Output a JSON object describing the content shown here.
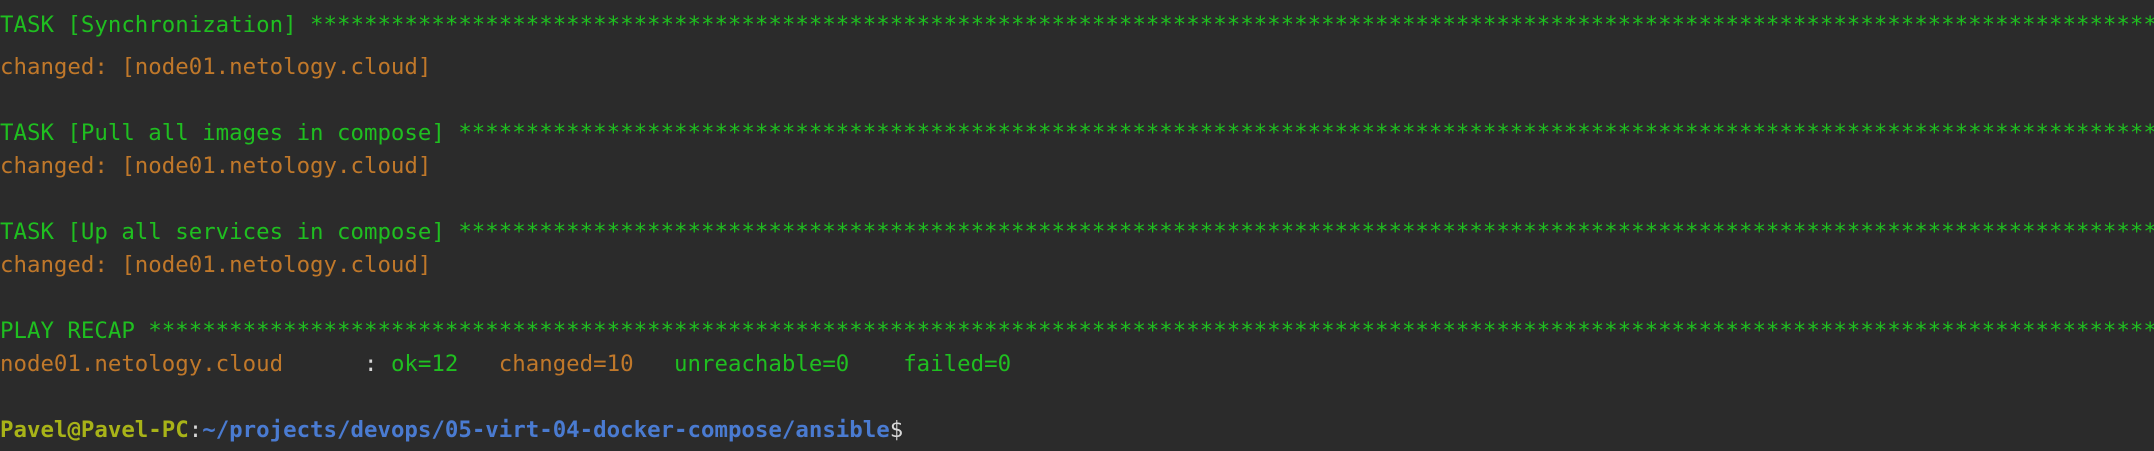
{
  "terminal": {
    "lines": {
      "task_sync": "TASK [Synchronization] ****************************************************************************************************************************************************************************************************************",
      "changed_sync": "changed: [node01.netology.cloud]",
      "task_pull": "TASK [Pull all images in compose] ****************************************************************************************************************************************************************************************************************",
      "changed_pull": "changed: [node01.netology.cloud]",
      "task_up": "TASK [Up all services in compose] ****************************************************************************************************************************************************************************************************************",
      "changed_up": "changed: [node01.netology.cloud]",
      "play_recap": "PLAY RECAP ****************************************************************************************************************************************************************************************************************"
    },
    "recap": {
      "host": "node01.netology.cloud      ",
      "separator": ": ",
      "ok": "ok=12   ",
      "changed": "changed=10   ",
      "unreachable": "unreachable=0    ",
      "failed": "failed=0"
    },
    "prompt": {
      "user_host": "Pavel@Pavel-PC",
      "colon": ":",
      "path": "~/projects/devops/05-virt-04-docker-compose/ansible",
      "symbol": "$"
    },
    "colors": {
      "background": "#2b2b2b",
      "task_green": "#1fbf20",
      "changed_orange": "#c0782a",
      "prompt_user": "#a8b318",
      "prompt_path": "#4a7bd1"
    }
  }
}
